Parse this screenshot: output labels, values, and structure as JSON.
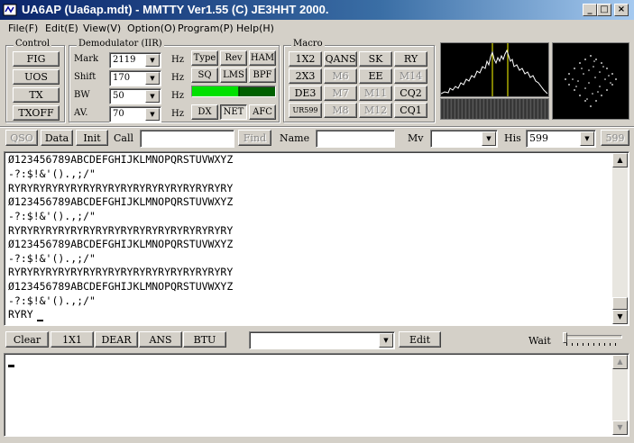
{
  "window": {
    "title": "UA6AP (Ua6ap.mdt) - MMTTY Ver1.55 (C) JE3HHT 2000.",
    "minimize_glyph": "_",
    "maximize_glyph": "□",
    "close_glyph": "×"
  },
  "menu": [
    "File(F)",
    "Edit(E)",
    "View(V)",
    "Option(O)",
    "Program(P)",
    "Help(H)"
  ],
  "control": {
    "group_label": "Control",
    "buttons": [
      "FIG",
      "UOS",
      "TX",
      "TXOFF"
    ]
  },
  "demodulator": {
    "group_label": "Demodulator (IIR)",
    "rows": [
      {
        "label": "Mark",
        "value": "2119",
        "unit": "Hz"
      },
      {
        "label": "Shift",
        "value": "170",
        "unit": "Hz"
      },
      {
        "label": "BW",
        "value": "50",
        "unit": "Hz"
      },
      {
        "label": "AV.",
        "value": "70",
        "unit": "Hz"
      }
    ],
    "buttons": [
      "Type",
      "Rev",
      "HAM",
      "SQ",
      "LMS",
      "BPF",
      "DX",
      "NET",
      "AFC"
    ],
    "level_fraction": 0.55
  },
  "macro": {
    "group_label": "Macro",
    "buttons": [
      "1X2",
      "QANS",
      "SK",
      "RY",
      "2X3",
      "M6",
      "EE",
      "M14",
      "DE3",
      "M7",
      "M11",
      "CQ2",
      "UR599",
      "M8",
      "M12",
      "CQ1"
    ]
  },
  "callbar": {
    "qso": "QSO",
    "data": "Data",
    "init": "Init",
    "call_label": "Call",
    "find": "Find",
    "name_label": "Name",
    "mv_label": "Mv",
    "his_label": "His",
    "his_value": "599",
    "his_button": "599"
  },
  "rx_lines": [
    "Ø123456789ABCDEFGHIJKLMNOPQRSTUVWXYZ",
    "-?:$!&'().,;/\"",
    "RYRYRYRYRYRYRYRYRYRYRYRYRYRYRYRYRYRY",
    "Ø123456789ABCDEFGHIJKLMNOPQRSTUVWXYZ",
    "-?:$!&'().,;/\"",
    "RYRYRYRYRYRYRYRYRYRYRYRYRYRYRYRYRYRY",
    "Ø123456789ABCDEFGHIJKLMNOPQRSTUVWXYZ",
    "-?:$!&'().,;/\"",
    "RYRYRYRYRYRYRYRYRYRYRYRYRYRYRYRYRYRY",
    "Ø123456789ABCDEFGHIJKLMNOPQRSTUVWXYZ",
    "-?:$!&'().,;/\"",
    "RYRY"
  ],
  "txbar": {
    "buttons": [
      "Clear",
      "1X1",
      "DEAR",
      "ANS",
      "BTU"
    ],
    "edit": "Edit",
    "wait_label": "Wait"
  },
  "colors": {
    "title_start": "#0a246a",
    "title_end": "#a6caf0",
    "level": "#00e000",
    "scope_bg": "#000000",
    "marker": "#ffff00"
  }
}
